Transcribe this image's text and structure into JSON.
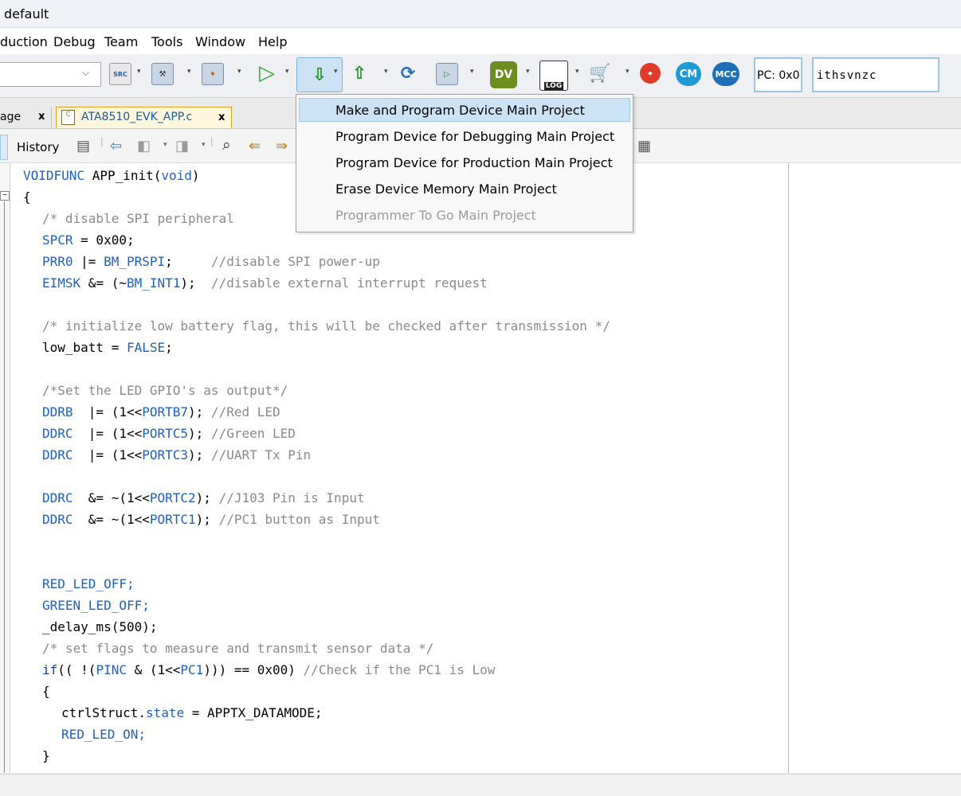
{
  "window": {
    "title": "default"
  },
  "menu": {
    "items": [
      "duction",
      "Debug",
      "Team",
      "Tools",
      "Window",
      "Help"
    ]
  },
  "toolbar": {
    "pc_label": "PC: 0x0",
    "flags_label": "ithsvnzc",
    "icons": [
      "src-check-icon",
      "build-icon",
      "clean-build-icon",
      "run-icon",
      "program-device-icon",
      "upload-icon",
      "reload-icon",
      "debug-build-icon",
      "dv-icon",
      "log-icon",
      "cart-icon",
      "marketplace-icon",
      "cm-icon",
      "mcc-icon"
    ],
    "icon_texts": {
      "src": "SRC",
      "dv": "DV",
      "log": "LOG",
      "cm": "CM",
      "mcc": "MCC"
    }
  },
  "tabs": [
    {
      "label": "age",
      "active": false
    },
    {
      "label": "ATA8510_EVK_APP.c",
      "active": true
    }
  ],
  "editor_toolbar": {
    "history_label": "History"
  },
  "popup_menu": {
    "items": [
      {
        "label": "Make and Program Device Main Project",
        "selected": true,
        "enabled": true
      },
      {
        "label": "Program Device for Debugging Main Project",
        "selected": false,
        "enabled": true
      },
      {
        "label": "Program Device for Production Main Project",
        "selected": false,
        "enabled": true
      },
      {
        "label": "Erase Device Memory Main Project",
        "selected": false,
        "enabled": true
      },
      {
        "label": "Programmer To Go Main Project",
        "selected": false,
        "enabled": false
      }
    ]
  },
  "code": {
    "l1a": "VOIDFUNC",
    "l1b": " APP_init(",
    "l1c": "void",
    "l1d": ")",
    "l2": "{",
    "l3": "/* disable SPI peripheral",
    "l4a": "SPCR",
    "l4b": " = 0x00;",
    "l5a": "PRR0",
    "l5b": " |= ",
    "l5c": "BM_PRSPI",
    "l5d": ";     ",
    "l5e": "//disable SPI power-up",
    "l6a": "EIMSK",
    "l6b": " &= (~",
    "l6c": "BM_INT1",
    "l6d": ");  ",
    "l6e": "//disable external interrupt request",
    "l7": "/* initialize low battery flag, this will be checked after transmission */",
    "l8a": "low_batt = ",
    "l8b": "FALSE",
    "l8c": ";",
    "l9": "/*Set the LED GPIO's as output*/",
    "l10a": "DDRB",
    "l10b": "  |= (1<<",
    "l10c": "PORTB7",
    "l10d": "); ",
    "l10e": "//Red LED",
    "l11a": "DDRC",
    "l11b": "  |= (1<<",
    "l11c": "PORTC5",
    "l11d": "); ",
    "l11e": "//Green LED",
    "l12a": "DDRC",
    "l12b": "  |= (1<<",
    "l12c": "PORTC3",
    "l12d": "); ",
    "l12e": "//UART Tx Pin",
    "l13a": "DDRC",
    "l13b": "  &= ~(1<<",
    "l13c": "PORTC2",
    "l13d": "); ",
    "l13e": "//J103 Pin is Input",
    "l14a": "DDRC",
    "l14b": "  &= ~(1<<",
    "l14c": "PORTC1",
    "l14d": "); ",
    "l14e": "//PC1 button as Input",
    "l15": "RED_LED_OFF;",
    "l16": "GREEN_LED_OFF;",
    "l17": "_delay_ms(500);",
    "l18": "/* set flags to measure and transmit sensor data */",
    "l19a": "if",
    "l19b": "(( !(",
    "l19c": "PINC",
    "l19d": " & (1<<",
    "l19e": "PC1",
    "l19f": "))) == 0x00) ",
    "l19g": "//Check if the PC1 is Low",
    "l20": "{",
    "l21a": "ctrlStruct.",
    "l21b": "state",
    "l21c": " = APPTX_DATAMODE;",
    "l22": "RED_LED_ON;",
    "l23": "}"
  }
}
